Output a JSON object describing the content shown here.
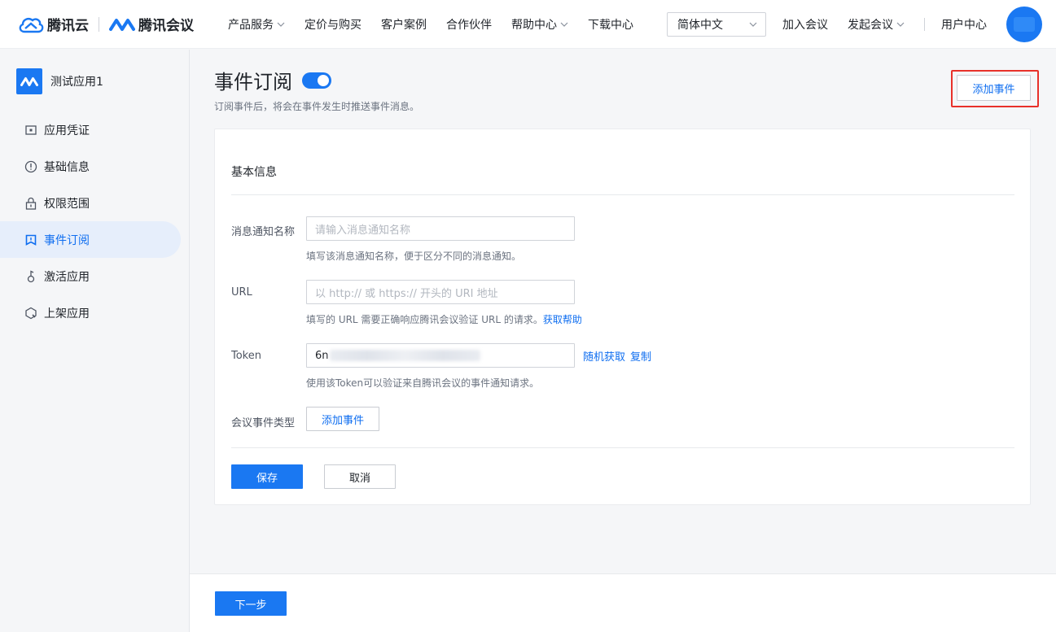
{
  "brand": {
    "cloud_name": "腾讯云",
    "meeting_name": "腾讯会议",
    "cloud_color": "#1a78f2"
  },
  "nav": {
    "items": [
      {
        "label": "产品服务",
        "has_dropdown": true
      },
      {
        "label": "定价与购买",
        "has_dropdown": false
      },
      {
        "label": "客户案例",
        "has_dropdown": false
      },
      {
        "label": "合作伙伴",
        "has_dropdown": false
      },
      {
        "label": "帮助中心",
        "has_dropdown": true
      },
      {
        "label": "下载中心",
        "has_dropdown": false
      }
    ],
    "language": "简体中文",
    "join_meeting": "加入会议",
    "start_meeting": "发起会议",
    "user_center": "用户中心"
  },
  "sidebar": {
    "app_name": "测试应用1",
    "items": [
      {
        "label": "应用凭证",
        "icon": "credential-icon",
        "active": false
      },
      {
        "label": "基础信息",
        "icon": "info-circle-icon",
        "active": false
      },
      {
        "label": "权限范围",
        "icon": "lock-icon",
        "active": false
      },
      {
        "label": "事件订阅",
        "icon": "bookmark-icon",
        "active": true
      },
      {
        "label": "激活应用",
        "icon": "activate-icon",
        "active": false
      },
      {
        "label": "上架应用",
        "icon": "publish-icon",
        "active": false
      }
    ]
  },
  "page": {
    "title": "事件订阅",
    "toggle_on": true,
    "subtitle": "订阅事件后，将会在事件发生时推送事件消息。",
    "add_event_top": "添加事件",
    "highlight_color": "#e8312a"
  },
  "form": {
    "section_title": "基本信息",
    "name": {
      "label": "消息通知名称",
      "placeholder": "请输入消息通知名称",
      "help": "填写该消息通知名称，便于区分不同的消息通知。"
    },
    "url": {
      "label": "URL",
      "placeholder": "以 http:// 或 https:// 开头的 URI 地址",
      "help": "填写的 URL 需要正确响应腾讯会议验证 URL 的请求。",
      "help_link": "获取帮助"
    },
    "token": {
      "label": "Token",
      "value_prefix": "6n",
      "random_link": "随机获取",
      "copy_link": "复制",
      "help": "使用该Token可以验证来自腾讯会议的事件通知请求。"
    },
    "event_type": {
      "label": "会议事件类型",
      "add_button": "添加事件"
    },
    "save": "保存",
    "cancel": "取消"
  },
  "footer": {
    "next": "下一步"
  },
  "colors": {
    "primary": "#1a78f2",
    "link": "#0f6ef0",
    "active_bg": "#e6eefb"
  }
}
